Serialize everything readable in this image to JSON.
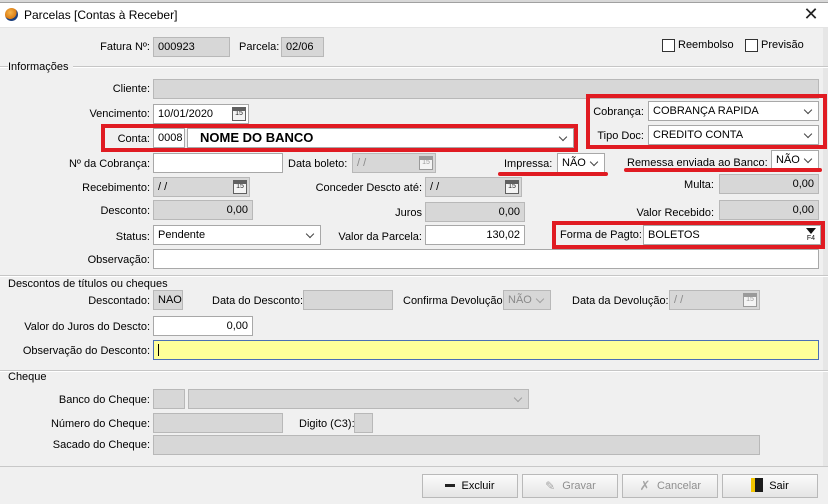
{
  "window": {
    "title": "Parcelas  [Contas à Receber]"
  },
  "header": {
    "fatura_label": "Fatura Nº:",
    "fatura_value": "000923",
    "parcela_label": "Parcela:",
    "parcela_value": "02/06",
    "reembolso_label": "Reembolso",
    "reembolso_checked": false,
    "previsao_label": "Previsão",
    "previsao_checked": false
  },
  "informacoes": {
    "section_label": "Informações",
    "cliente_label": "Cliente:",
    "cliente_value": "",
    "vencimento_label": "Vencimento:",
    "vencimento_value": "10/01/2020",
    "conta_label": "Conta:",
    "conta_code": "0008",
    "conta_name": "NOME DO BANCO",
    "cobranca_label": "Cobrança:",
    "cobranca_value": "COBRANÇA RAPIDA",
    "tipo_doc_label": "Tipo Doc:",
    "tipo_doc_value": "CREDITO CONTA",
    "num_cobranca_label": "Nº da Cobrança:",
    "num_cobranca_value": "",
    "data_boleto_label": "Data boleto:",
    "data_boleto_value": "/ /",
    "impressa_label": "Impressa:",
    "impressa_value": "NÃO",
    "remessa_label": "Remessa enviada ao Banco:",
    "remessa_value": "NÃO",
    "recebimento_label": "Recebimento:",
    "recebimento_value": "/ /",
    "conceder_label": "Conceder Descto até:",
    "conceder_value": "/ /",
    "multa_label": "Multa:",
    "multa_value": "0,00",
    "desconto_label": "Desconto:",
    "desconto_value": "0,00",
    "juros_label": "Juros",
    "juros_value": "0,00",
    "valor_recebido_label": "Valor Recebido:",
    "valor_recebido_value": "0,00",
    "status_label": "Status:",
    "status_value": "Pendente",
    "valor_parcela_label": "Valor da Parcela:",
    "valor_parcela_value": "130,02",
    "forma_pagto_label": "Forma de Pagto:",
    "forma_pagto_value": "BOLETOS",
    "forma_pagto_key": "F4",
    "observacao_label": "Observação:",
    "observacao_value": ""
  },
  "descontos": {
    "section_label": "Descontos de títulos ou cheques",
    "descontado_label": "Descontado:",
    "descontado_value": "NAO",
    "data_desconto_label": "Data do Desconto:",
    "data_desconto_value": "",
    "confirma_label": "Confirma Devolução:",
    "confirma_value": "NÃO",
    "data_devolucao_label": "Data da Devolução:",
    "data_devolucao_value": "/ /",
    "valor_juros_label": "Valor do Juros  do Descto:",
    "valor_juros_value": "0,00",
    "obs_desconto_label": "Observação do Desconto:",
    "obs_desconto_value": ""
  },
  "cheque": {
    "section_label": "Cheque",
    "banco_label": "Banco do Cheque:",
    "banco_code": "",
    "banco_name": "",
    "numero_label": "Número do Cheque:",
    "numero_value": "",
    "digito_label": "Digito (C3):",
    "digito_value": "",
    "sacado_label": "Sacado do Cheque:",
    "sacado_value": ""
  },
  "buttons": {
    "excluir": "Excluir",
    "gravar": "Gravar",
    "cancelar": "Cancelar",
    "sair": "Sair"
  },
  "icons": {
    "window": "app-logo-icon",
    "close": "close-icon",
    "calendar": "calendar-icon",
    "dropdown": "chevron-down-icon",
    "lookup": "lookup-f4-icon",
    "delete": "minus-icon",
    "save": "pencil-icon",
    "cancel": "x-icon",
    "exit": "exit-door-icon"
  },
  "colors": {
    "highlight_red": "#e01b22",
    "focused_field": "#ffff99",
    "readonly_field": "#d7d7d7"
  }
}
